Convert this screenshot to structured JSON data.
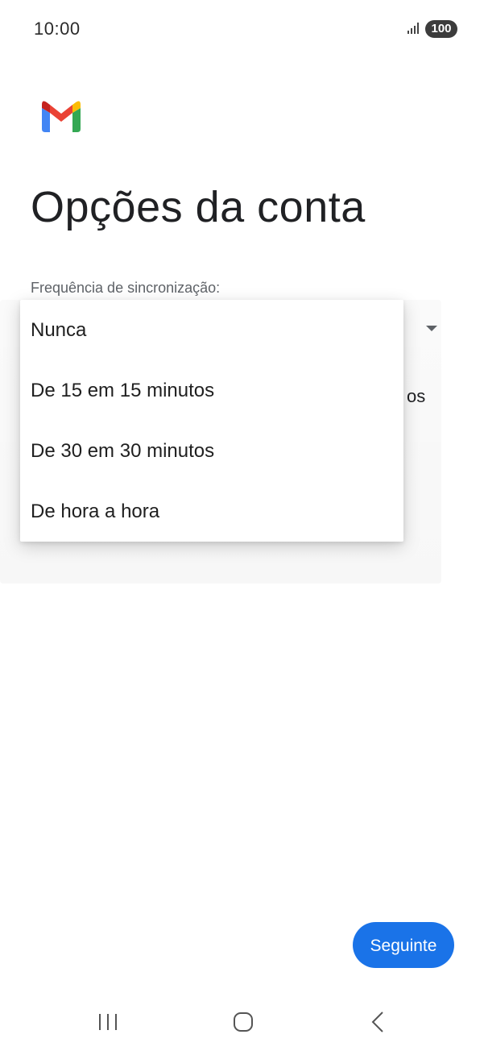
{
  "status_bar": {
    "time": "10:00",
    "battery": "100",
    "icons": [
      "signal-icon",
      "battery-icon"
    ]
  },
  "logo": {
    "name": "gmail-logo",
    "colors": [
      "#4285F4",
      "#EA4335",
      "#FBBC04",
      "#34A853",
      "#C5221F"
    ]
  },
  "page": {
    "title": "Opções da conta"
  },
  "sync": {
    "label": "Frequência de sincronização:",
    "underlying_partial_text": "os",
    "options": [
      "Nunca",
      "De 15 em 15 minutos",
      "De 30 em 30 minutos",
      "De hora a hora"
    ]
  },
  "actions": {
    "next_label": "Seguinte",
    "accent_color": "#1a73e8"
  },
  "nav_bar": {
    "icons": [
      "recents-icon",
      "home-icon",
      "back-icon"
    ]
  }
}
